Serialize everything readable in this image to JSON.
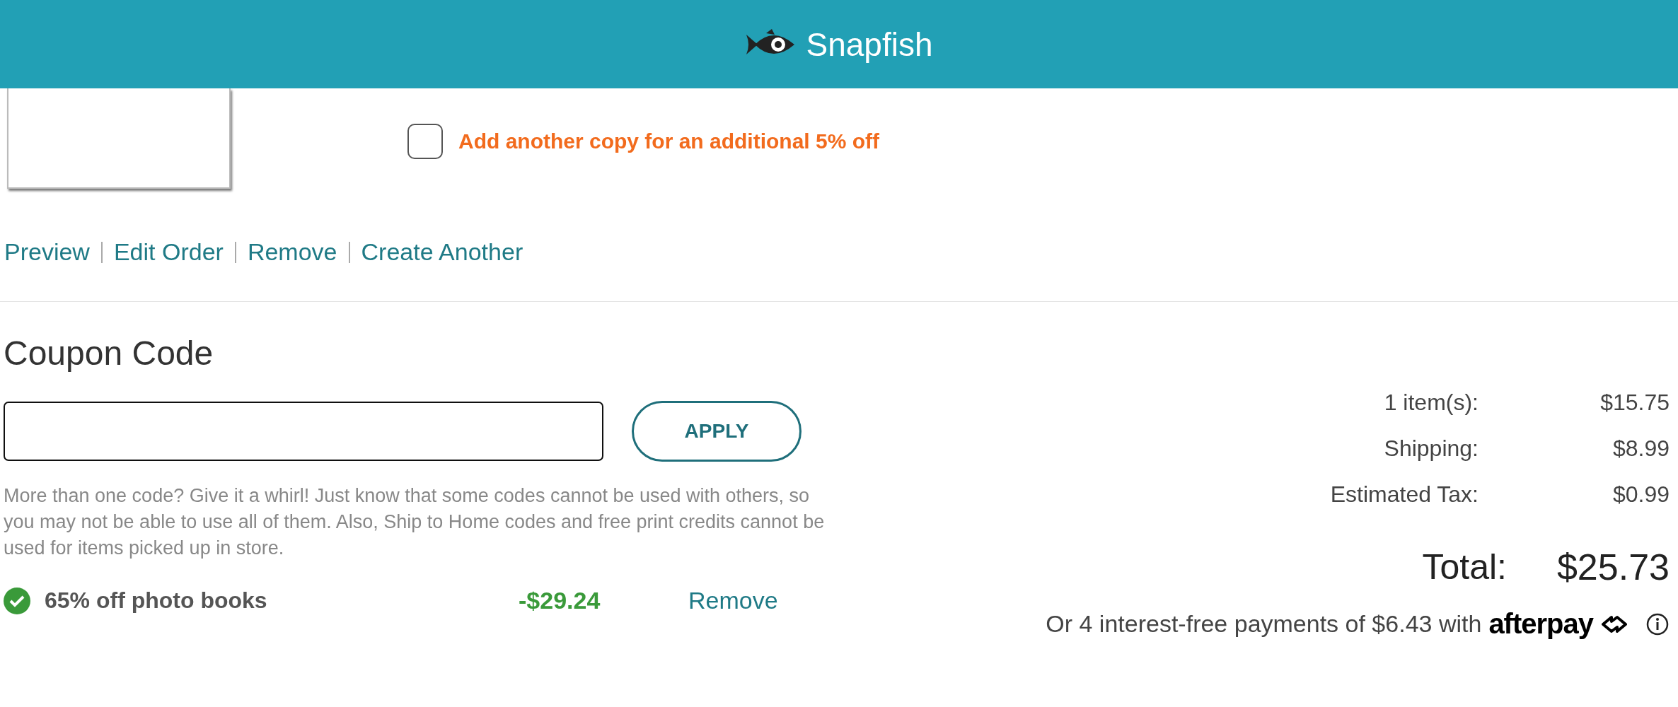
{
  "header": {
    "brand": "Snapfish"
  },
  "product": {
    "addon": {
      "label": "Add another copy for an additional 5% off",
      "checked": false
    },
    "actions": [
      "Preview",
      "Edit Order",
      "Remove",
      "Create Another"
    ]
  },
  "coupon": {
    "title": "Coupon Code",
    "apply": "APPLY",
    "help": "More than one code? Give it a whirl! Just know that some codes cannot be used with others, so you may not be able to use all of them. Also, Ship to Home codes and free print credits cannot be used for items picked up in store.",
    "applied": [
      {
        "label": "65% off photo books",
        "amount": "-$29.24",
        "action": "Remove"
      }
    ]
  },
  "summary": {
    "rows": [
      {
        "label": "1 item(s):",
        "value": "$15.75"
      },
      {
        "label": "Shipping:",
        "value": "$8.99"
      },
      {
        "label": "Estimated Tax:",
        "value": "$0.99"
      }
    ],
    "total": {
      "label": "Total:",
      "value": "$25.73"
    },
    "afterpay": {
      "text": "Or 4 interest-free payments of $6.43 with",
      "brand": "afterpay"
    }
  }
}
